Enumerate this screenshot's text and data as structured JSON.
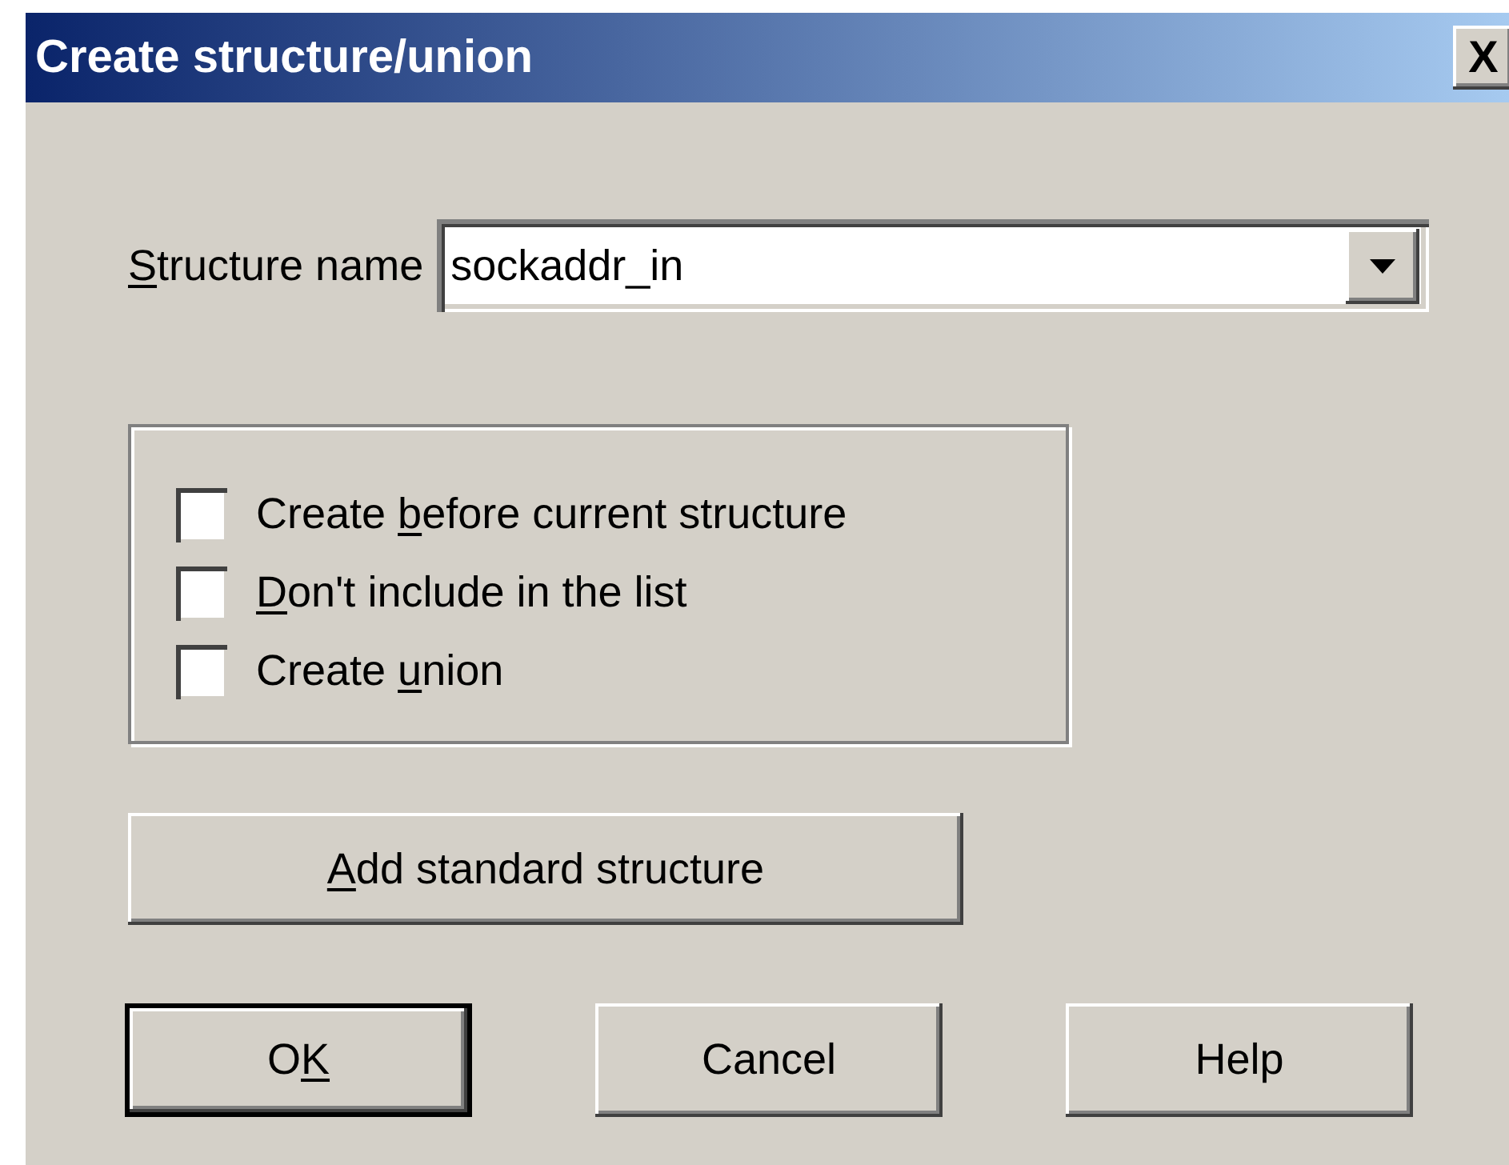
{
  "window": {
    "title": "Create structure/union",
    "close_button": "X"
  },
  "structure_name": {
    "label": {
      "key": "S",
      "after": "tructure name"
    },
    "value": "sockaddr_in"
  },
  "options": [
    {
      "label": {
        "before": "Create ",
        "key": "b",
        "after": "efore current structure"
      },
      "checked": false
    },
    {
      "label": {
        "key": "D",
        "after": "on't include in the list"
      },
      "checked": false
    },
    {
      "label": {
        "before": "Create ",
        "key": "u",
        "after": "nion"
      },
      "checked": false
    }
  ],
  "add_button": {
    "label": {
      "key": "A",
      "after": "dd standard structure"
    }
  },
  "buttons": [
    {
      "label": {
        "before": "O",
        "key": "K"
      },
      "default": true
    },
    {
      "label": {
        "before": "Cancel"
      },
      "default": false
    },
    {
      "label": {
        "before": "Help"
      },
      "default": false
    }
  ]
}
